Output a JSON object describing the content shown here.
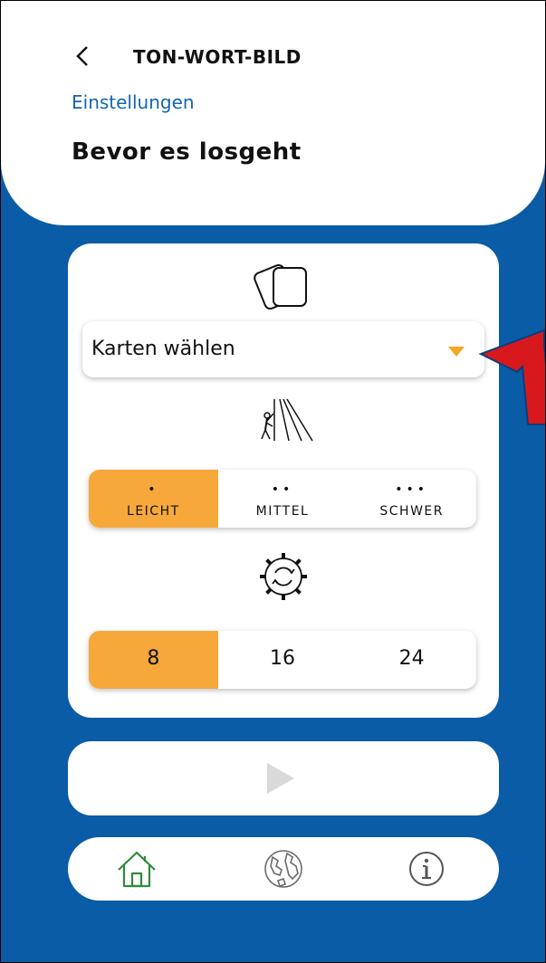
{
  "header": {
    "app_title": "TON-WORT-BILD",
    "breadcrumb": "Einstellungen",
    "page_title": "Bevor es losgeht"
  },
  "settings": {
    "card_select": {
      "label": "Karten wählen"
    },
    "difficulty": {
      "options": [
        {
          "dots": "•",
          "label": "LEICHT",
          "selected": true
        },
        {
          "dots": "••",
          "label": "MITTEL",
          "selected": false
        },
        {
          "dots": "•••",
          "label": "SCHWER",
          "selected": false
        }
      ]
    },
    "count": {
      "options": [
        {
          "label": "8",
          "selected": true
        },
        {
          "label": "16",
          "selected": false
        },
        {
          "label": "24",
          "selected": false
        }
      ]
    }
  },
  "icons": {
    "back": "chevron-left-icon",
    "cards": "cards-icon",
    "climb": "climbing-icon",
    "gear": "gear-refresh-icon",
    "play": "play-icon",
    "home": "home-icon",
    "globe": "globe-icon",
    "info": "info-icon"
  },
  "colors": {
    "background": "#0b5ca6",
    "accent": "#f6a83b",
    "dropdown_arrow": "#f5a623",
    "link": "#1565b0",
    "home_active": "#2e8b3a",
    "annotation_arrow": "#d7191e"
  }
}
